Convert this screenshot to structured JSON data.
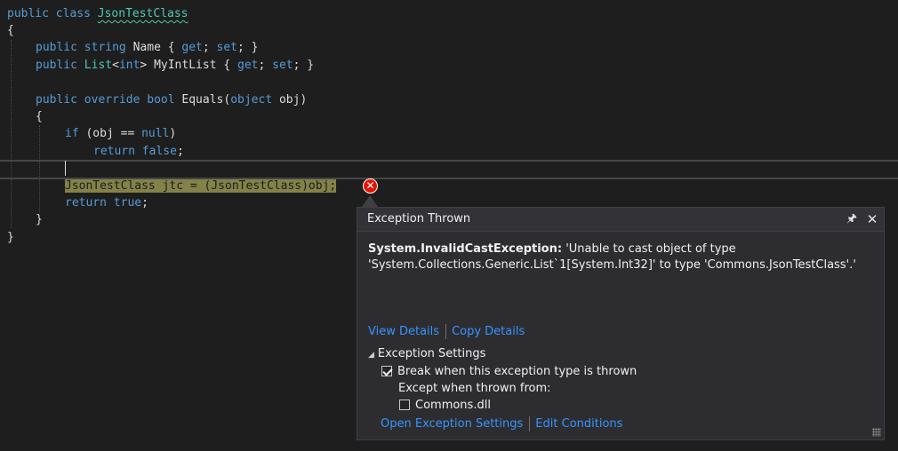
{
  "code": {
    "line1": {
      "kw1": "public",
      "kw2": "class",
      "name": "JsonTestClass"
    },
    "line2": "{",
    "line3": {
      "kw1": "public",
      "kw2": "string",
      "rest": "Name { ",
      "get": "get",
      "mid": "; ",
      "set": "set",
      "end": "; }"
    },
    "line4": {
      "kw1": "public",
      "type": "List",
      "lt": "<",
      "kw2": "int",
      "rest": "> MyIntList { ",
      "get": "get",
      "mid": "; ",
      "set": "set",
      "end": "; }"
    },
    "line5": {
      "kw1": "public",
      "kw2": "override",
      "kw3": "bool",
      "mid": "Equals(",
      "kw4": "object",
      "end": "obj)"
    },
    "line6": "{",
    "line7": {
      "kw": "if",
      "a": "(obj == ",
      "null": "null",
      "b": ")"
    },
    "line8": {
      "kw": "return",
      "val": "false",
      "end": ";"
    },
    "line9": {
      "text": "JsonTestClass jtc = (JsonTestClass)obj;"
    },
    "line10": {
      "kw": "return",
      "val": "true",
      "end": ";"
    },
    "line11": "}",
    "line12": "}"
  },
  "error_glyph": "✕",
  "popup": {
    "title": "Exception Thrown",
    "pin": "🖈",
    "close": "✕",
    "exception_type": "System.InvalidCastException:",
    "message_line1": " 'Unable to cast object of type",
    "message_line2": "'System.Collections.Generic.List`1[System.Int32]' to type 'Commons.JsonTestClass'.'",
    "view_details": "View Details",
    "copy_details": "Copy Details",
    "settings_title": "Exception Settings",
    "break_label": "Break when this exception type is thrown",
    "break_checked": true,
    "except_label": "Except when thrown from:",
    "commons_label": "Commons.dll",
    "commons_checked": false,
    "open_settings": "Open Exception Settings",
    "edit_conditions": "Edit Conditions"
  }
}
